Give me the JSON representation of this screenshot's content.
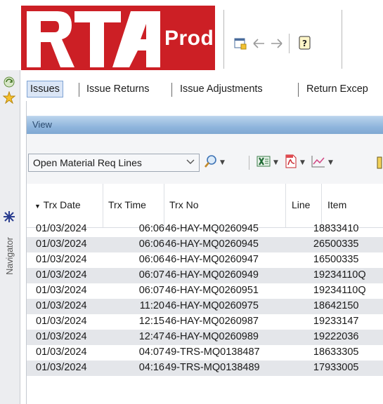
{
  "header": {
    "logo_text": "RTA",
    "environment_label": "Prod",
    "toolbar_icons": [
      "new-window-icon",
      "back-arrow-icon",
      "forward-arrow-icon",
      "help-icon"
    ]
  },
  "navigator": {
    "label": "Navigator",
    "icons": [
      "refresh-icon",
      "favorites-star-icon",
      "navigator-tree-icon"
    ]
  },
  "tabs": [
    {
      "label": "Issues",
      "active": true
    },
    {
      "label": "Issue Returns",
      "active": false
    },
    {
      "label": "Issue Adjustments",
      "active": false
    },
    {
      "label": "Return Excep",
      "active": false
    }
  ],
  "view_bar": {
    "title": "View"
  },
  "query": {
    "selected": "Open Material Req Lines",
    "tools": [
      "search-icon",
      "excel-export-icon",
      "pdf-export-icon",
      "chart-icon"
    ]
  },
  "grid": {
    "sort_indicator": "▼",
    "columns": [
      "Trx Date",
      "Trx Time",
      "Trx No",
      "Line",
      "Item"
    ],
    "rows": [
      {
        "date": "01/03/2024",
        "time": "06:06",
        "trx": "46-HAY-MQ0260945",
        "line": "1",
        "item": "8833410"
      },
      {
        "date": "01/03/2024",
        "time": "06:06",
        "trx": "46-HAY-MQ0260945",
        "line": "2",
        "item": "6500335"
      },
      {
        "date": "01/03/2024",
        "time": "06:06",
        "trx": "46-HAY-MQ0260947",
        "line": "1",
        "item": "6500335"
      },
      {
        "date": "01/03/2024",
        "time": "06:07",
        "trx": "46-HAY-MQ0260949",
        "line": "1",
        "item": "9234110Q"
      },
      {
        "date": "01/03/2024",
        "time": "06:07",
        "trx": "46-HAY-MQ0260951",
        "line": "1",
        "item": "9234110Q"
      },
      {
        "date": "01/03/2024",
        "time": "11:20",
        "trx": "46-HAY-MQ0260975",
        "line": "1",
        "item": "8642150"
      },
      {
        "date": "01/03/2024",
        "time": "12:15",
        "trx": "46-HAY-MQ0260987",
        "line": "1",
        "item": "9233147"
      },
      {
        "date": "01/03/2024",
        "time": "12:47",
        "trx": "46-HAY-MQ0260989",
        "line": "1",
        "item": "9222036"
      },
      {
        "date": "01/03/2024",
        "time": "04:07",
        "trx": "49-TRS-MQ0138487",
        "line": "1",
        "item": "8633305"
      },
      {
        "date": "01/03/2024",
        "time": "04:16",
        "trx": "49-TRS-MQ0138489",
        "line": "1",
        "item": "7933005"
      }
    ]
  }
}
